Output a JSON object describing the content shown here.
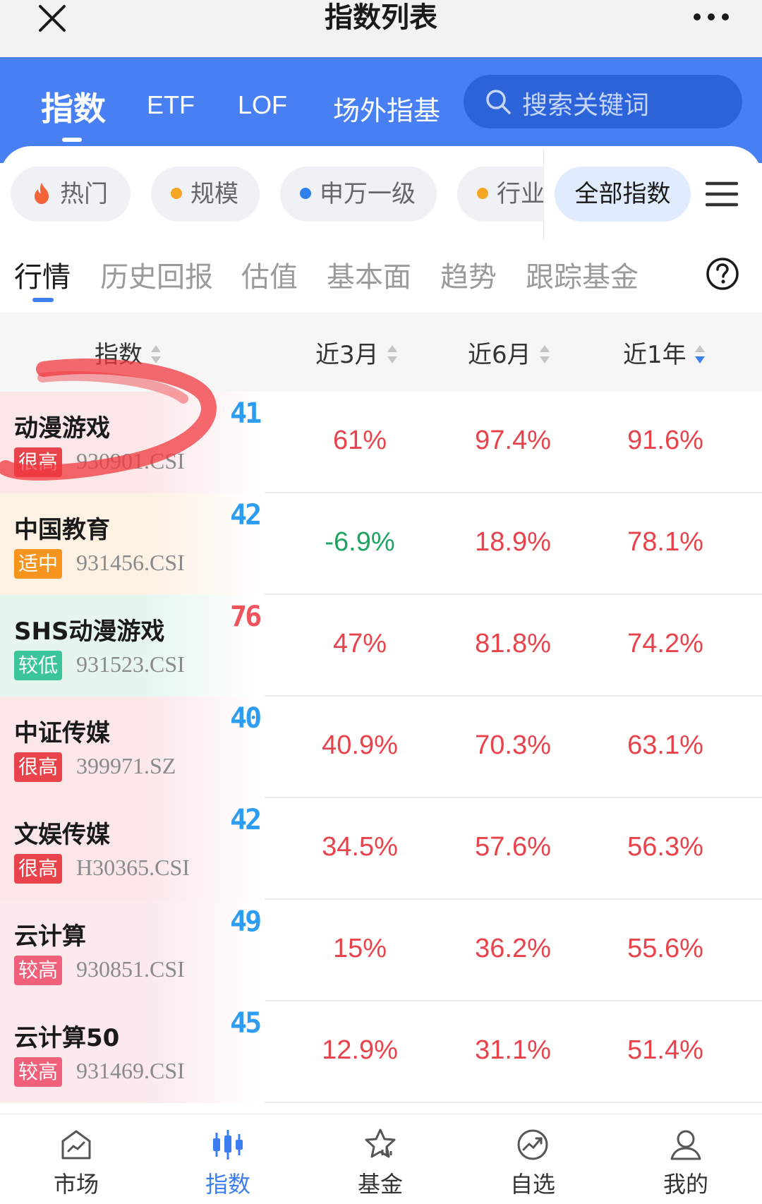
{
  "title_bar": {
    "title": "指数列表"
  },
  "top_tabs": [
    {
      "label": "指数",
      "active": true
    },
    {
      "label": "ETF",
      "active": false
    },
    {
      "label": "LOF",
      "active": false
    },
    {
      "label": "场外指基",
      "active": false
    }
  ],
  "search": {
    "placeholder": "搜索关键词"
  },
  "filter_chips": [
    {
      "label": "热门",
      "icon": "fire-icon",
      "dot_color": "#f4623a"
    },
    {
      "label": "规模",
      "icon": "dot",
      "dot_color": "#f5a623"
    },
    {
      "label": "申万一级",
      "icon": "dot",
      "dot_color": "#2f80ed"
    },
    {
      "label": "行业",
      "icon": "dot",
      "dot_color": "#f5a623"
    }
  ],
  "all_indices_chip": "全部指数",
  "sub_tabs": [
    {
      "label": "行情",
      "active": true
    },
    {
      "label": "历史回报",
      "active": false
    },
    {
      "label": "估值",
      "active": false
    },
    {
      "label": "基本面",
      "active": false
    },
    {
      "label": "趋势",
      "active": false
    },
    {
      "label": "跟踪基金",
      "active": false
    }
  ],
  "table": {
    "headers": [
      "指数",
      "近3月",
      "近6月",
      "近1年"
    ],
    "sort_active_column": "近1年",
    "rows": [
      {
        "name": "动漫游戏",
        "badge": "很高",
        "badge_color": "#e8424a",
        "code": "930901.CSI",
        "score": "41",
        "score_color": "#2e9cf0",
        "m3": "61%",
        "m6": "97.4%",
        "y1": "91.6%",
        "m3_color": "#e8424a",
        "tint": "#fbe7e8"
      },
      {
        "name": "中国教育",
        "badge": "适中",
        "badge_color": "#f7941d",
        "code": "931456.CSI",
        "score": "42",
        "score_color": "#2e9cf0",
        "m3": "-6.9%",
        "m6": "18.9%",
        "y1": "78.1%",
        "m3_color": "#1fa361",
        "tint": "#fdf1e3"
      },
      {
        "name": "SHS动漫游戏",
        "badge": "较低",
        "badge_color": "#3cc49a",
        "code": "931523.CSI",
        "score": "76",
        "score_color": "#f0545a",
        "m3": "47%",
        "m6": "81.8%",
        "y1": "74.2%",
        "m3_color": "#e8424a",
        "tint": "#e6f6ef"
      },
      {
        "name": "中证传媒",
        "badge": "很高",
        "badge_color": "#e8424a",
        "code": "399971.SZ",
        "score": "40",
        "score_color": "#2e9cf0",
        "m3": "40.9%",
        "m6": "70.3%",
        "y1": "63.1%",
        "m3_color": "#e8424a",
        "tint": "#fbe7e8"
      },
      {
        "name": "文娱传媒",
        "badge": "很高",
        "badge_color": "#e8424a",
        "code": "H30365.CSI",
        "score": "42",
        "score_color": "#2e9cf0",
        "m3": "34.5%",
        "m6": "57.6%",
        "y1": "56.3%",
        "m3_color": "#e8424a",
        "tint": "#fbe7e8"
      },
      {
        "name": "云计算",
        "badge": "较高",
        "badge_color": "#f0607a",
        "code": "930851.CSI",
        "score": "49",
        "score_color": "#2e9cf0",
        "m3": "15%",
        "m6": "36.2%",
        "y1": "55.6%",
        "m3_color": "#e8424a",
        "tint": "#fbe9ec"
      },
      {
        "name": "云计算50",
        "badge": "较高",
        "badge_color": "#f0607a",
        "code": "931469.CSI",
        "score": "45",
        "score_color": "#2e9cf0",
        "m3": "12.9%",
        "m6": "31.1%",
        "y1": "51.4%",
        "m3_color": "#e8424a",
        "tint": "#fbe9ec"
      }
    ]
  },
  "bottom_nav": [
    {
      "label": "市场",
      "icon": "market-icon",
      "active": false
    },
    {
      "label": "指数",
      "icon": "candlestick-icon",
      "active": true
    },
    {
      "label": "基金",
      "icon": "fund-icon",
      "active": false
    },
    {
      "label": "自选",
      "icon": "watchlist-icon",
      "active": false
    },
    {
      "label": "我的",
      "icon": "profile-icon",
      "active": false
    }
  ],
  "colors": {
    "brand_blue": "#4880f3",
    "rise_red": "#e8424a",
    "fall_green": "#1fa361",
    "accent": "#3b7ef1"
  }
}
